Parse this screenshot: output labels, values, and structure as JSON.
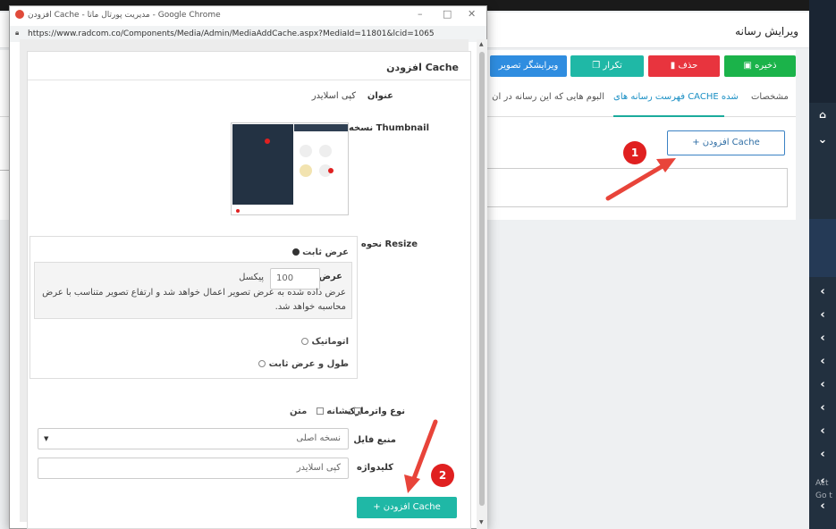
{
  "browser": {
    "window_title": "افزودن Cache - مدیریت پورتال ماتا - Google Chrome",
    "url": "https://www.radcom.co/Components/Media/Admin/MediaAddCache.aspx?MediaId=11801&lcid=1065"
  },
  "page": {
    "title": "ویرایش رسانه",
    "buttons": {
      "save": "ذخیره",
      "delete": "حذف",
      "duplicate": "تکرار",
      "image_editor": "ویرایشگر تصویر"
    },
    "tabs": [
      {
        "label": "مشخصات"
      },
      {
        "label": "فهرست رسانه های CACHE شده"
      },
      {
        "label": "آلبوم هایی که این رسانه در آن قرار دارد"
      }
    ],
    "add_cache_label": "افزودن Cache"
  },
  "dialog": {
    "title": "افزودن Cache",
    "title_label": "عنوان",
    "title_value": "کپی اسلایدر",
    "thumbnail_label": "نسخه Thumbnail",
    "resize_label": "نحوه ی Resize",
    "resize_fixed_width": "عرض ثابت",
    "width_label": "عرض",
    "width_value": "100",
    "width_unit": "پیکسل",
    "width_help": "عرض داده شده به عرض تصویر اعمال خواهد شد و ارتفاع تصویر متناسب با عرض محاسبه خواهد شد.",
    "resize_auto": "اتوماتیک",
    "resize_fixed_both": "طول و عرض ثابت",
    "watermark_label": "نوع واترمارک",
    "watermark_text": "متن",
    "watermark_logo": "نشانه",
    "source_label": "منبع فایل",
    "source_value": "نسخه اصلی",
    "keyword_label": "کلیدواژه",
    "keyword_placeholder": "کپی اسلایدر",
    "submit_label": "افزودن Cache"
  },
  "markers": [
    "1",
    "2"
  ],
  "side_text": [
    "Act",
    "Go t"
  ],
  "colors": {
    "save": "#1bb34a",
    "delete": "#e8343e",
    "teal": "#1fb8a6",
    "blue": "#2f8de0",
    "marker": "#e02020",
    "arrow": "#e8443a"
  }
}
